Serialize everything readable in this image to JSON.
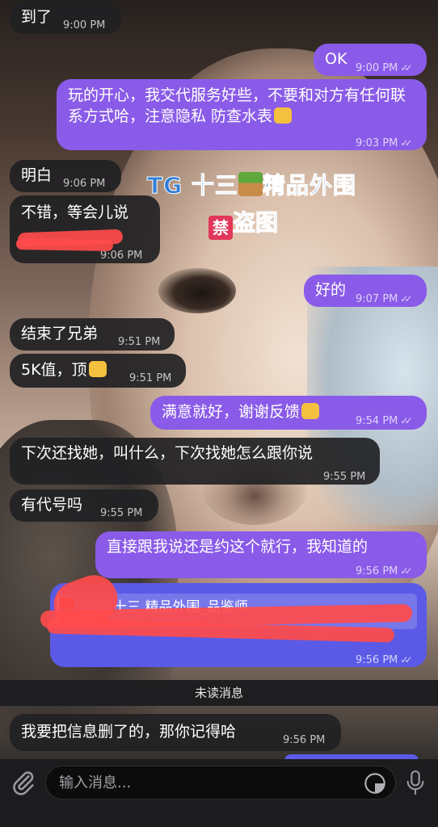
{
  "colors": {
    "incoming_bubble": "#212123",
    "outgoing_bubble": "#8a5be8",
    "outgoing_forward_bubble": "#5b5ae6",
    "watermark": "#2f7fd8",
    "redaction": "#ff4b4b"
  },
  "watermark": {
    "line1_prefix": "TG 十三",
    "line1_suffix": "精品外围",
    "line2": "盗图"
  },
  "messages": [
    {
      "dir": "in",
      "text": "到了",
      "time": "9:00 PM"
    },
    {
      "dir": "out",
      "text": "OK",
      "time": "9:00 PM",
      "read": true
    },
    {
      "dir": "out",
      "text": "玩的开心，我交代服务好些，不要和对方有任何联系方式哈，注意隐私 防查水表",
      "time": "9:03 PM",
      "read": true,
      "emoji": "handshake-emoji"
    },
    {
      "dir": "in",
      "text": "明白",
      "time": "9:06 PM"
    },
    {
      "dir": "in",
      "text": "不错，等会儿说",
      "time": "9:06 PM",
      "redacted": true
    },
    {
      "dir": "out",
      "text": "好的",
      "time": "9:07 PM",
      "read": true
    },
    {
      "dir": "in",
      "text": "结束了兄弟",
      "time": "9:51 PM"
    },
    {
      "dir": "in",
      "text": "5K值，顶",
      "time": "9:51 PM",
      "emoji": "thumbs-up-emoji"
    },
    {
      "dir": "out",
      "text": "满意就好，谢谢反馈",
      "time": "9:54 PM",
      "read": true,
      "emoji": "handshake-emoji"
    },
    {
      "dir": "in",
      "text": "下次还找她，叫什么，下次找她怎么跟你说",
      "time": "9:55 PM"
    },
    {
      "dir": "in",
      "text": "有代号吗",
      "time": "9:55 PM"
    },
    {
      "dir": "out",
      "text": "直接跟我说还是约这个就行，我知道的",
      "time": "9:56 PM",
      "read": true
    },
    {
      "dir": "out",
      "forward_label": "十三 精品外围_品鉴师",
      "time": "9:56 PM",
      "read": true,
      "redacted": true
    },
    {
      "dir": "in",
      "text": "我要把信息删了的，那你记得哈",
      "time": "9:56 PM"
    }
  ],
  "unread_divider": "未读消息",
  "composer": {
    "placeholder": "输入消息..."
  },
  "icons": {
    "attach": "paperclip-icon",
    "sticker": "sticker-icon",
    "mic": "microphone-icon",
    "read_status": "double-check-icon"
  }
}
